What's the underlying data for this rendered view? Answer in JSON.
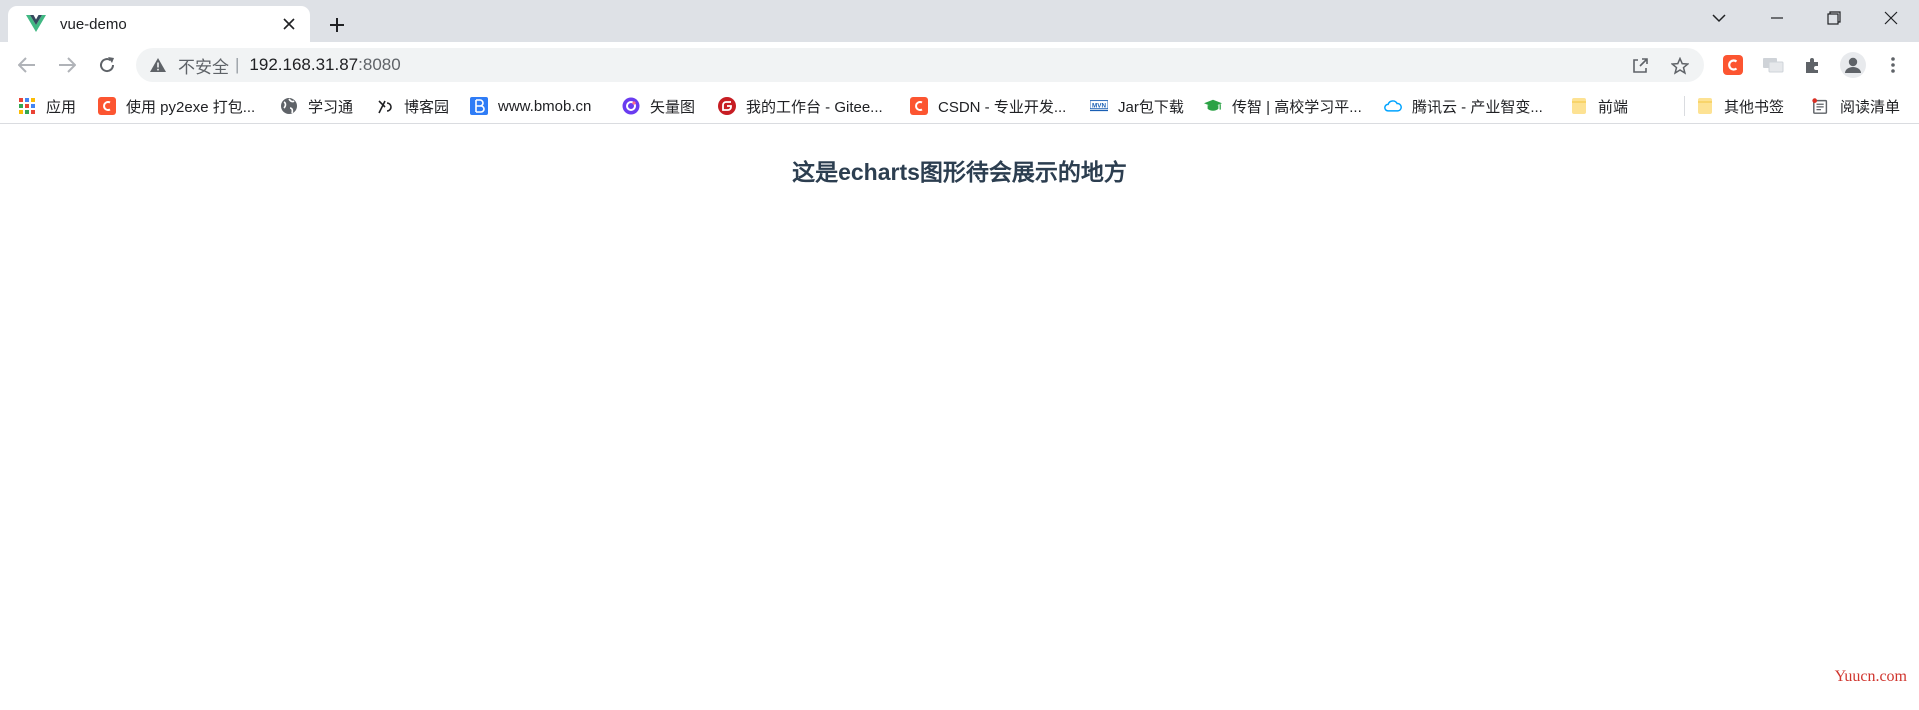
{
  "tab": {
    "title": "vue-demo"
  },
  "omnibox": {
    "insecure_label": "不安全",
    "separator": "|",
    "host": "192.168.31.87",
    "port": ":8080"
  },
  "bookmarks": {
    "items": [
      {
        "label": "应用",
        "icon": "apps-grid-icon"
      },
      {
        "label": "使用 py2exe 打包...",
        "icon": "csdn-icon"
      },
      {
        "label": "学习通",
        "icon": "globe-icon"
      },
      {
        "label": "博客园",
        "icon": "cnblogs-icon"
      },
      {
        "label": "www.bmob.cn",
        "icon": "bmob-icon"
      },
      {
        "label": "矢量图",
        "icon": "iconfont-icon"
      },
      {
        "label": "我的工作台 - Gitee...",
        "icon": "gitee-icon"
      },
      {
        "label": "CSDN - 专业开发...",
        "icon": "csdn-icon"
      },
      {
        "label": "Jar包下载",
        "icon": "mvn-icon"
      },
      {
        "label": "传智 | 高校学习平...",
        "icon": "graduation-cap-icon"
      },
      {
        "label": "腾讯云 - 产业智变...",
        "icon": "tencent-cloud-icon"
      },
      {
        "label": "前端",
        "icon": "folder-icon"
      },
      {
        "label": "其他书签",
        "icon": "folder-icon"
      },
      {
        "label": "阅读清单",
        "icon": "reading-list-icon"
      }
    ]
  },
  "page": {
    "heading": "这是echarts图形待会展示的地方"
  },
  "watermark": {
    "text": "Yuucn.com"
  },
  "colors": {
    "tab_strip": "#dee1e6",
    "omnibox": "#f1f3f4",
    "heading": "#2c3e50",
    "csdn": "#fc5531",
    "vue_green": "#41b883",
    "watermark": "#d0352e"
  }
}
